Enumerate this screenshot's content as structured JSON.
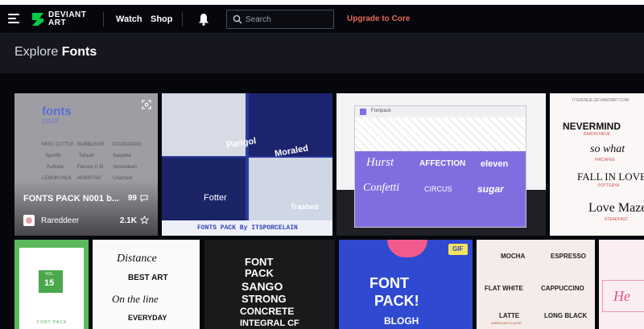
{
  "nav": {
    "logo_line1": "DEVIANT",
    "logo_line2": "ART",
    "watch": "Watch",
    "shop": "Shop",
    "search_placeholder": "Search",
    "upgrade": "Upgrade to Core"
  },
  "header": {
    "prefix": "Explore",
    "topic": "Fonts"
  },
  "cards": [
    {
      "title": "FONTS PACK N001 b...",
      "comments": "99",
      "user": "Rareddeer",
      "favs": "2.1K",
      "art": {
        "brand": "fonts",
        "sub": "pack",
        "samples": [
          "MISC CUTTLE",
          "BUBBLEIGE",
          "DOODADOO",
          "Sportfd",
          "Tahyall",
          "Sarpetta",
          "Rufinda",
          "Fances U III",
          "Seckodeen",
          "LEMON MILK",
          "ARBISTAR",
          "Chamber"
        ]
      }
    },
    {
      "caption": "FONTS PACK By ITSPORCELAIN",
      "labels": [
        "Fotter",
        "Trashed",
        "Parigol",
        "Moraled"
      ]
    },
    {
      "window_title": "Fontpack",
      "labels": [
        "Hurst",
        "AFFECTION",
        "eleven",
        "Confetti",
        "CIRCUS",
        "sugar"
      ]
    },
    {
      "credit": "ITSVENUE.DEVIANTART.COM",
      "labels": [
        "NEVERMIND",
        "BARON NEUE",
        "so what",
        "FIRCAFEE",
        "FALL IN LOVE",
        "POTTERYA",
        "Love Maze",
        "STEADFAST"
      ]
    },
    {
      "badge_vol": "VOL.",
      "badge_num": "15",
      "footer": "FONT PACK"
    },
    {
      "labels": [
        "Distance",
        "BEST ART",
        "On the line",
        "EVERYDAY"
      ]
    },
    {
      "labels": [
        "FONT",
        "PACK",
        "SANGO",
        "STRONG",
        "CONCRETE",
        "INTEGRAL CF"
      ]
    },
    {
      "tag": "GIF",
      "labels": [
        "FONT",
        "PACK!",
        "BLOGH"
      ]
    },
    {
      "labels": [
        "MOCHA",
        "ESPRESSO",
        "FLAT WHITE",
        "CAPPUCCINO",
        "LATTE",
        "LONG BLACK",
        "AMERICAN FLAVOR"
      ]
    },
    {
      "labels": [
        "He"
      ]
    }
  ]
}
